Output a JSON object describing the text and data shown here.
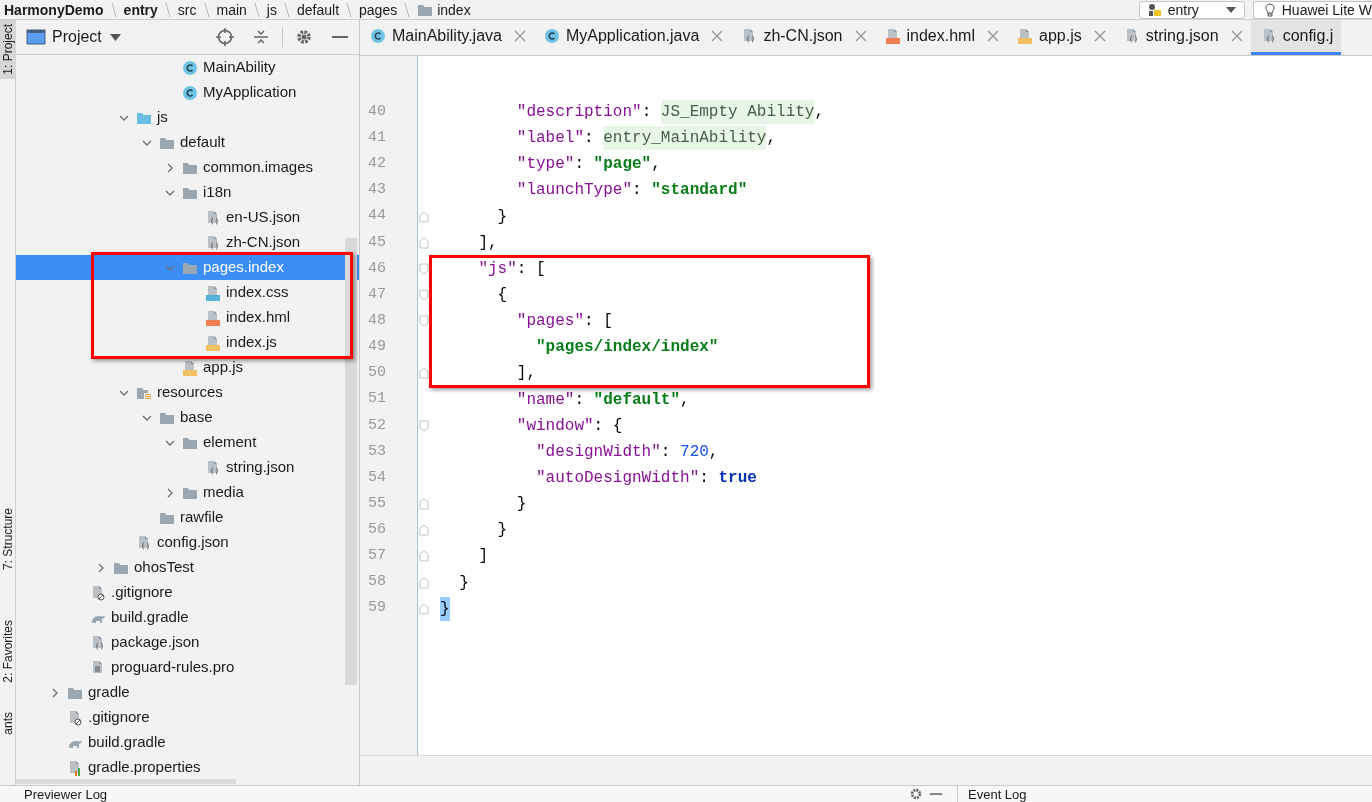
{
  "breadcrumb": {
    "items": [
      {
        "label": "HarmonyDemo",
        "bold": true
      },
      {
        "label": "entry",
        "bold": true
      },
      {
        "label": "src",
        "bold": false
      },
      {
        "label": "main",
        "bold": false
      },
      {
        "label": "js",
        "bold": false
      },
      {
        "label": "default",
        "bold": false
      },
      {
        "label": "pages",
        "bold": false
      },
      {
        "label": "index",
        "bold": false,
        "kind": "folder"
      }
    ],
    "config_selector": {
      "label": "entry"
    },
    "device_selector": {
      "label": "Huawei Lite W"
    }
  },
  "side_strip": [
    {
      "label": "1: Project",
      "selected": true
    },
    {
      "label": "7: Structure",
      "selected": false
    },
    {
      "label": "2: Favorites",
      "selected": false
    },
    {
      "label": "ants",
      "selected": false
    }
  ],
  "project_panel": {
    "title": "Project",
    "tree": [
      {
        "children": [
          {
            "children": [
              {
                "children": [
                  {
                    "children": [
                      {
                        "children": [
                          {
                            "label": "MainAbility",
                            "kind": "class",
                            "selected": false
                          },
                          {
                            "label": "MyApplication",
                            "kind": "class",
                            "selected": false
                          }
                        ]
                      }
                    ]
                  },
                  {
                    "label": "js",
                    "kind": "js-folder",
                    "expanded": true,
                    "selected": false,
                    "children": [
                      {
                        "label": "default",
                        "kind": "folder",
                        "expanded": true,
                        "selected": false,
                        "children": [
                          {
                            "label": "common.images",
                            "kind": "folder",
                            "expanded": false,
                            "selected": false
                          },
                          {
                            "label": "i18n",
                            "kind": "folder",
                            "expanded": true,
                            "selected": false,
                            "children": [
                              {
                                "label": "en-US.json",
                                "kind": "json",
                                "selected": false
                              },
                              {
                                "label": "zh-CN.json",
                                "kind": "json",
                                "selected": false
                              }
                            ]
                          },
                          {
                            "label": "pages.index",
                            "kind": "folder",
                            "expanded": true,
                            "selected": true,
                            "children": [
                              {
                                "label": "index.css",
                                "kind": "css",
                                "selected": false
                              },
                              {
                                "label": "index.hml",
                                "kind": "hml",
                                "selected": false
                              },
                              {
                                "label": "index.js",
                                "kind": "js",
                                "selected": false
                              }
                            ]
                          },
                          {
                            "label": "app.js",
                            "kind": "js",
                            "selected": false
                          }
                        ]
                      }
                    ]
                  },
                  {
                    "label": "resources",
                    "kind": "resources-folder",
                    "expanded": true,
                    "selected": false,
                    "children": [
                      {
                        "label": "base",
                        "kind": "folder",
                        "expanded": true,
                        "selected": false,
                        "children": [
                          {
                            "label": "element",
                            "kind": "folder",
                            "expanded": true,
                            "selected": false,
                            "children": [
                              {
                                "label": "string.json",
                                "kind": "json",
                                "selected": false
                              }
                            ]
                          },
                          {
                            "label": "media",
                            "kind": "folder",
                            "expanded": false,
                            "selected": false
                          }
                        ]
                      },
                      {
                        "label": "rawfile",
                        "kind": "folder",
                        "selected": false
                      }
                    ]
                  },
                  {
                    "label": "config.json",
                    "kind": "json",
                    "selected": false
                  }
                ]
              },
              {
                "label": "ohosTest",
                "kind": "folder",
                "expanded": false,
                "selected": false
              }
            ]
          },
          {
            "label": ".gitignore",
            "kind": "ignore",
            "selected": false
          },
          {
            "label": "build.gradle",
            "kind": "gradle",
            "selected": false
          },
          {
            "label": "package.json",
            "kind": "json",
            "selected": false
          },
          {
            "label": "proguard-rules.pro",
            "kind": "text",
            "selected": false
          }
        ]
      },
      {
        "label": "gradle",
        "kind": "folder",
        "expanded": false,
        "selected": false
      },
      {
        "label": ".gitignore",
        "kind": "ignore",
        "selected": false
      },
      {
        "label": "build.gradle",
        "kind": "gradle",
        "selected": false
      },
      {
        "label": "gradle.properties",
        "kind": "properties",
        "selected": false
      }
    ]
  },
  "editor_tabs": [
    {
      "label": "MainAbility.java",
      "kind": "class",
      "selected": false
    },
    {
      "label": "MyApplication.java",
      "kind": "class",
      "selected": false
    },
    {
      "label": "zh-CN.json",
      "kind": "json",
      "selected": false
    },
    {
      "label": "index.hml",
      "kind": "hml",
      "selected": false
    },
    {
      "label": "app.js",
      "kind": "js",
      "selected": false
    },
    {
      "label": "string.json",
      "kind": "json",
      "selected": false
    },
    {
      "label": "config.j",
      "kind": "json",
      "selected": true
    }
  ],
  "code_lines": [
    {
      "children": [
        {
          "children": [
            {
              "children": [
                {
                  "children": [
                    {
                      "number": "40",
                      "tokens": [
                        {
                          "kind": "key",
                          "text": "\"description\""
                        },
                        {
                          "kind": "punct",
                          "text": ": "
                        },
                        {
                          "kind": "reference",
                          "text": "JS_Empty Ability"
                        },
                        {
                          "kind": "punct",
                          "text": ","
                        }
                      ]
                    },
                    {
                      "number": "41",
                      "tokens": [
                        {
                          "kind": "key",
                          "text": "\"label\""
                        },
                        {
                          "kind": "punct",
                          "text": ": "
                        },
                        {
                          "kind": "reference",
                          "text": "entry_MainAbility"
                        },
                        {
                          "kind": "punct",
                          "text": ","
                        }
                      ]
                    },
                    {
                      "number": "42",
                      "tokens": [
                        {
                          "kind": "key",
                          "text": "\"type\""
                        },
                        {
                          "kind": "punct",
                          "text": ": "
                        },
                        {
                          "kind": "string",
                          "text": "\"page\""
                        },
                        {
                          "kind": "punct",
                          "text": ","
                        }
                      ]
                    },
                    {
                      "number": "43",
                      "tokens": [
                        {
                          "kind": "key",
                          "text": "\"launchType\""
                        },
                        {
                          "kind": "punct",
                          "text": ": "
                        },
                        {
                          "kind": "string",
                          "text": "\"standard\""
                        }
                      ]
                    }
                  ]
                },
                {
                  "number": "44",
                  "kind": "fold-end",
                  "tokens": [
                    {
                      "kind": "punct",
                      "text": "}"
                    }
                  ]
                }
              ]
            },
            {
              "number": "45",
              "kind": "fold-end",
              "tokens": [
                {
                  "kind": "punct",
                  "text": "],"
                }
              ]
            },
            {
              "number": "46",
              "kind": "fold-start",
              "tokens": [
                {
                  "kind": "key",
                  "text": "\"js\""
                },
                {
                  "kind": "punct",
                  "text": ": ["
                }
              ],
              "children": [
                {
                  "number": "47",
                  "kind": "fold-start",
                  "tokens": [
                    {
                      "kind": "punct",
                      "text": "{"
                    }
                  ],
                  "children": [
                    {
                      "number": "48",
                      "kind": "fold-start",
                      "tokens": [
                        {
                          "kind": "key",
                          "text": "\"pages\""
                        },
                        {
                          "kind": "punct",
                          "text": ": ["
                        }
                      ],
                      "children": [
                        {
                          "number": "49",
                          "tokens": [
                            {
                              "kind": "string",
                              "text": "\"pages/index/index\""
                            }
                          ]
                        }
                      ]
                    },
                    {
                      "number": "50",
                      "kind": "fold-end",
                      "tokens": [
                        {
                          "kind": "punct",
                          "text": "],"
                        }
                      ]
                    },
                    {
                      "number": "51",
                      "tokens": [
                        {
                          "kind": "key",
                          "text": "\"name\""
                        },
                        {
                          "kind": "punct",
                          "text": ": "
                        },
                        {
                          "kind": "string",
                          "text": "\"default\""
                        },
                        {
                          "kind": "punct",
                          "text": ","
                        }
                      ]
                    },
                    {
                      "number": "52",
                      "kind": "fold-start",
                      "tokens": [
                        {
                          "kind": "key",
                          "text": "\"window\""
                        },
                        {
                          "kind": "punct",
                          "text": ": {"
                        }
                      ],
                      "children": [
                        {
                          "number": "53",
                          "tokens": [
                            {
                              "kind": "key",
                              "text": "\"designWidth\""
                            },
                            {
                              "kind": "punct",
                              "text": ": "
                            },
                            {
                              "kind": "number",
                              "text": "720"
                            },
                            {
                              "kind": "punct",
                              "text": ","
                            }
                          ]
                        },
                        {
                          "number": "54",
                          "tokens": [
                            {
                              "kind": "key",
                              "text": "\"autoDesignWidth\""
                            },
                            {
                              "kind": "punct",
                              "text": ": "
                            },
                            {
                              "kind": "keyword",
                              "text": "true"
                            }
                          ]
                        }
                      ]
                    },
                    {
                      "number": "55",
                      "kind": "fold-end",
                      "tokens": [
                        {
                          "kind": "punct",
                          "text": "}"
                        }
                      ]
                    }
                  ]
                },
                {
                  "number": "56",
                  "kind": "fold-end",
                  "tokens": [
                    {
                      "kind": "punct",
                      "text": "}"
                    }
                  ]
                }
              ]
            },
            {
              "number": "57",
              "kind": "fold-end",
              "tokens": [
                {
                  "kind": "punct",
                  "text": "]"
                }
              ]
            }
          ]
        },
        {
          "number": "58",
          "kind": "fold-end",
          "tokens": [
            {
              "kind": "punct",
              "text": "}"
            }
          ]
        }
      ]
    },
    {
      "number": "59",
      "kind": "fold-end",
      "tokens": [
        {
          "kind": "match",
          "text": "}"
        }
      ]
    }
  ],
  "bottom_panels": [
    {
      "label": "Previewer Log"
    },
    {
      "label": "Event Log"
    }
  ]
}
